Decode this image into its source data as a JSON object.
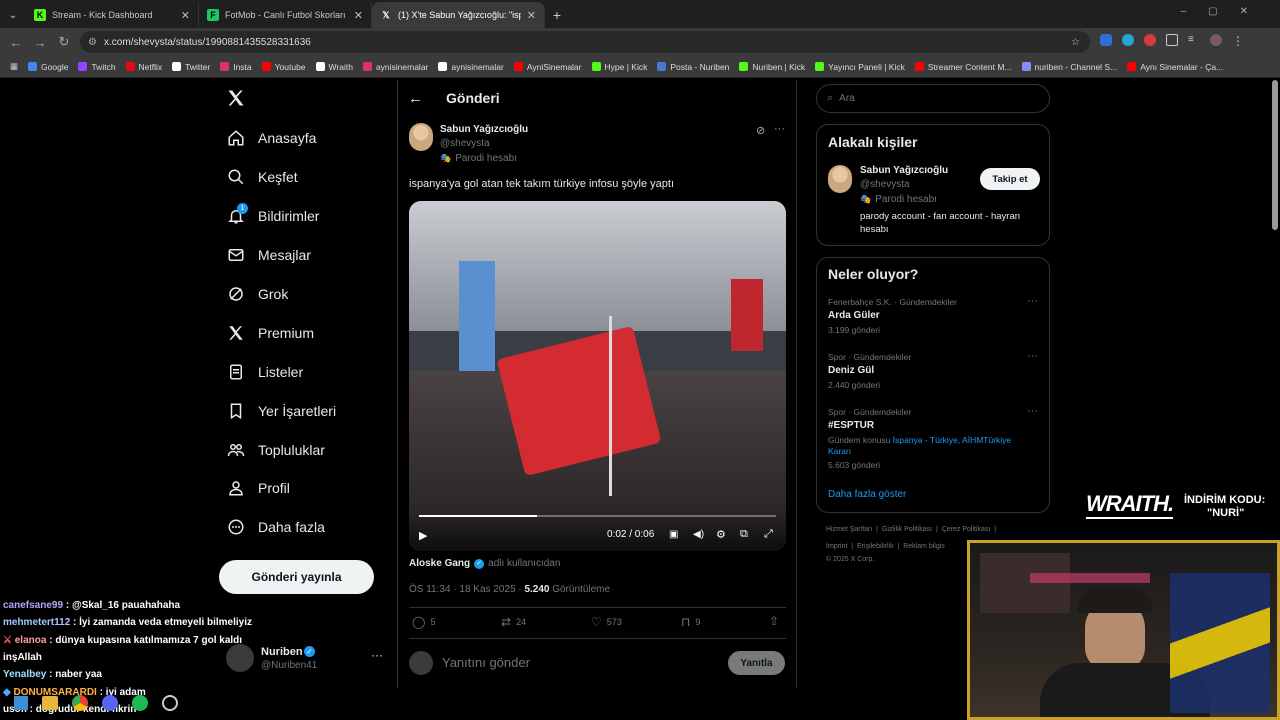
{
  "browser": {
    "tabs": [
      {
        "title": "Stream - Kick Dashboard",
        "icon": "kick-icon",
        "color": "#53fc18"
      },
      {
        "title": "FotMob - Canlı Futbol Skorları",
        "icon": "fotmob-icon",
        "color": "#18c964"
      },
      {
        "title": "(1) X'te Sabun Yağızcıoğlu: \"isp",
        "icon": "x-icon",
        "color": "#ffffff"
      }
    ],
    "url": "x.com/shevysta/status/1990881435528331636",
    "bookmarks": [
      "Google",
      "Twitch",
      "Netflix",
      "Twitter",
      "Insta",
      "Youtube",
      "Wraith",
      "aynisinemalar",
      "aynisinemalar",
      "AyniSinemalar",
      "Hype | Kick",
      "Posta - Nuriben",
      "Nuriben | Kick",
      "Yayıncı Paneli | Kick",
      "Streamer Content M...",
      "nuriben - Channel S...",
      "Aynı Sinemalar - Ça..."
    ]
  },
  "nav": {
    "items": [
      "Anasayfa",
      "Keşfet",
      "Bildirimler",
      "Mesajlar",
      "Grok",
      "Premium",
      "Listeler",
      "Yer İşaretleri",
      "Topluluklar",
      "Profil",
      "Daha fazla"
    ],
    "notif_badge": "1",
    "post_button": "Gönderi yayınla",
    "account_name": "Nuriben",
    "account_handle": "@Nuriben41"
  },
  "header": {
    "title": "Gönderi"
  },
  "post": {
    "author": "Sabun Yağızcıoğlu",
    "handle": "@shevysta",
    "parody": "Parodi hesabı",
    "text": "ispanya'ya gol atan tek takım türkiye infosu şöyle yaptı",
    "video_time": "0:02 / 0:06",
    "video_progress": 0.33,
    "from_user": "Aloske Gang",
    "from_suffix": "adlı kullanıcıdan",
    "timestamp": "ÖS 11:34 · 18 Kas 2025 · ",
    "views_count": "5.240",
    "views_label": "Görüntüleme",
    "replies": "5",
    "reposts": "24",
    "likes": "573",
    "bookmarks": "9",
    "reply_placeholder": "Yanıtını gönder",
    "reply_button": "Yanıtla"
  },
  "search": {
    "placeholder": "Ara"
  },
  "relevant": {
    "title": "Alakalı kişiler",
    "name": "Sabun Yağızcıoğlu",
    "handle": "@shevysta",
    "parody": "Parodi hesabı",
    "bio": "parody account - fan account - hayran hesabı",
    "follow": "Takip et"
  },
  "trends": {
    "title": "Neler oluyor?",
    "items": [
      {
        "context": "Fenerbahçe S.K. · Gündemdekiler",
        "name": "Arda Güler",
        "count": "3.199 gönderi"
      },
      {
        "context": "Spor · Gündemdekiler",
        "name": "Deniz Gül",
        "count": "2.440 gönderi"
      },
      {
        "context": "Spor · Gündemdekiler",
        "name": "#ESPTUR",
        "topic_prefix": "Gündem konusu",
        "topic_links": "İspanya - Türkiye, AİHMTürkiye Kararı",
        "count": "5.603 gönderi"
      }
    ],
    "show_more": "Daha fazla göster"
  },
  "footer": {
    "links1": [
      "Hizmet Şartları",
      "Gizlilik Politikası",
      "Çerez Politikası"
    ],
    "links2": [
      "Imprint",
      "Erişilebilirlik",
      "Reklam bilgis"
    ],
    "copyright": "© 2025 X Corp."
  },
  "overlay": {
    "brand": "WRAITH.",
    "code_label": "İNDİRİM KODU:",
    "code": "\"NURİ\""
  },
  "chat": [
    {
      "user": "canefsane99",
      "color": "#b9a3ff",
      "text": "@Skal_16 pauahahaha"
    },
    {
      "user": "mehmetert112",
      "color": "#a3c9ff",
      "text": "İyi zamanda veda etmeyeli bilmeliyiz"
    },
    {
      "user": "elanoa",
      "color": "#ff9f9f",
      "text": "dünya kupasına katılmamıza 7 gol kaldı"
    },
    {
      "user": "",
      "color": "#ffffff",
      "text": "inşAllah"
    },
    {
      "user": "Yenalbey",
      "color": "#9fe0ff",
      "text": "naber yaa"
    },
    {
      "user": "DONUMSARARDI",
      "color": "#ffb347",
      "text": "iyi adam"
    },
    {
      "user": "usofi",
      "color": "#ffffff",
      "text": "dogrudur kendi fikrin"
    }
  ]
}
